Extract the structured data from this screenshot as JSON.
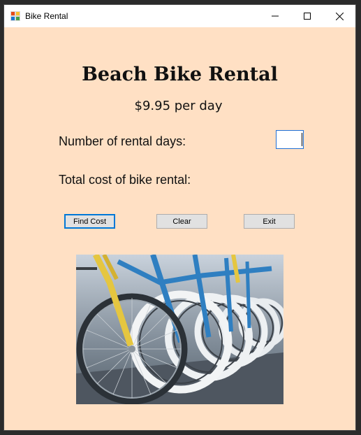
{
  "window": {
    "title": "Bike Rental"
  },
  "form": {
    "heading": "Beach Bike Rental",
    "rate": "$9.95 per day",
    "days_label": "Number of rental days:",
    "days_value": "",
    "total_label": "Total cost of bike rental:"
  },
  "buttons": {
    "find_cost": "Find Cost",
    "clear": "Clear",
    "exit": "Exit"
  },
  "colors": {
    "client_background": "#ffe0c4",
    "focus_border": "#0078d7"
  },
  "icons": [
    "app-icon",
    "minimize-icon",
    "maximize-icon",
    "close-icon"
  ],
  "image": "bicycles-photo"
}
